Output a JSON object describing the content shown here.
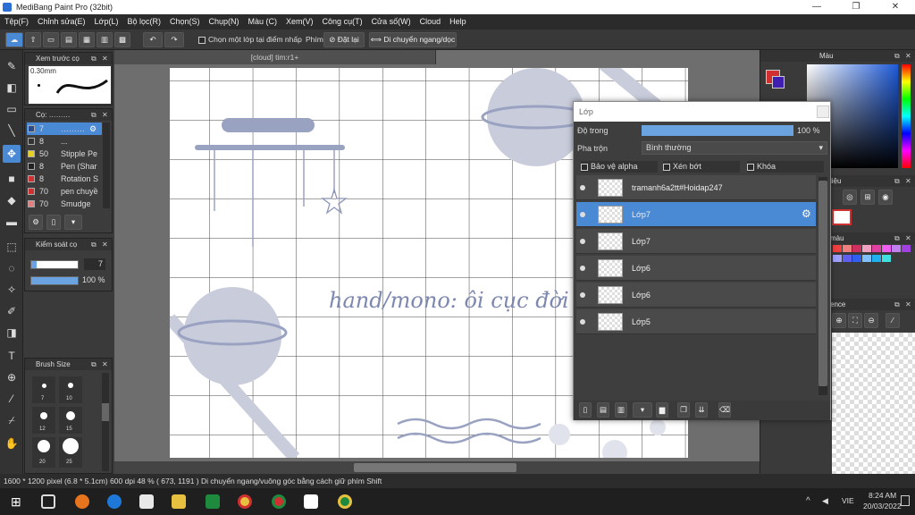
{
  "window": {
    "title": "MediBang Paint Pro (32bit)",
    "min": "—",
    "max": "❐",
    "close": "✕"
  },
  "menu": [
    "Tệp(F)",
    "Chỉnh sửa(E)",
    "Lớp(L)",
    "Bộ lọc(R)",
    "Chọn(S)",
    "Chụp(N)",
    "Màu (C)",
    "Xem(V)",
    "Công cụ(T)",
    "Cửa số(W)",
    "Cloud",
    "Help"
  ],
  "toolbar": {
    "select_one_layer": "Chọn một lớp tại điểm nhấp",
    "phim_label": "Phím",
    "reset": "Đặt lại",
    "move_hv": "Di chuyển ngang/dọc"
  },
  "brush_preview": {
    "title": "Xem trước cọ",
    "size": "0.30mm"
  },
  "brush_panel": {
    "title": "Cọ: ………",
    "items": [
      {
        "size": "7",
        "name": "………",
        "color": "#2a4a8a"
      },
      {
        "size": "8",
        "name": "...",
        "color": "#333333"
      },
      {
        "size": "50",
        "name": "Stipple Pe",
        "color": "#e8d020"
      },
      {
        "size": "8",
        "name": "Pen (Shar",
        "color": "#222222"
      },
      {
        "size": "8",
        "name": "Rotation S",
        "color": "#d03030"
      },
      {
        "size": "70",
        "name": "pen chuyề",
        "color": "#d03030"
      },
      {
        "size": "70",
        "name": "Smudge",
        "color": "#e08080"
      }
    ]
  },
  "brush_control": {
    "title": "Kiểm soát cọ",
    "size_value": "7",
    "opacity_value": "100 %"
  },
  "brush_size": {
    "title": "Brush Size",
    "labels": [
      "7",
      "10",
      "12",
      "15",
      "20",
      "25"
    ]
  },
  "document": {
    "tab": "[cloud] tim:r1+",
    "handwriting": "hand/mono: ôi cục đời"
  },
  "color_panel": {
    "title": "Màu"
  },
  "right_labels": {
    "brush_hint": "liệu",
    "palette": "màu",
    "reference": "ence"
  },
  "layer_window": {
    "title": "Lớp",
    "opacity_label": "Độ trong",
    "opacity_value": "100 %",
    "opacity_fraction": 1.0,
    "blend_label": "Pha trộn",
    "blend_value": "Bình thường",
    "protect_alpha": "Bảo vệ alpha",
    "clip": "Xén bớt",
    "lock": "Khóa",
    "layers": [
      {
        "name": "tramanh6a2tt#Hoidap247",
        "selected": false
      },
      {
        "name": "Lớp7",
        "selected": true
      },
      {
        "name": "Lớp7",
        "selected": false
      },
      {
        "name": "Lớp6",
        "selected": false
      },
      {
        "name": "Lớp6",
        "selected": false
      },
      {
        "name": "Lớp5",
        "selected": false
      }
    ]
  },
  "status": {
    "text": "1600 * 1200 pixel   (6.8 * 5.1cm)   600 dpi   48 %   ( 673, 1191 )   Di chuyển ngang/vuông góc bằng cách giữ phím Shift"
  },
  "taskbar": {
    "lang": "VIE",
    "time": "8:24 AM",
    "date": "20/03/2022",
    "tray_up": "^"
  },
  "colors": {
    "accent": "#4a8ad4",
    "shape": "#c9ccdb",
    "ink": "#7d88b0"
  }
}
